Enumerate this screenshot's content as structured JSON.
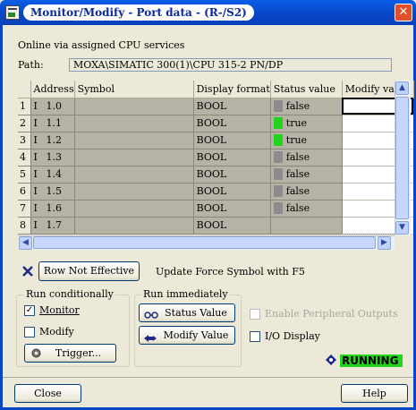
{
  "window": {
    "title": "Monitor/Modify - Port data - (R-/S2)",
    "close_symbol": "✕"
  },
  "connection_text": "Online via assigned CPU services",
  "path": {
    "label": "Path:",
    "value": "MOXA\\SIMATIC 300(1)\\CPU 315-2 PN/DP"
  },
  "table": {
    "headers": [
      "",
      "Address",
      "Symbol",
      "Display format",
      "Status value",
      "Modify value"
    ],
    "rows": [
      {
        "num": "1",
        "area": "I",
        "addr": "1.0",
        "symbol": "",
        "format": "BOOL",
        "status": "false",
        "modify": ""
      },
      {
        "num": "2",
        "area": "I",
        "addr": "1.1",
        "symbol": "",
        "format": "BOOL",
        "status": "true",
        "modify": ""
      },
      {
        "num": "3",
        "area": "I",
        "addr": "1.2",
        "symbol": "",
        "format": "BOOL",
        "status": "true",
        "modify": ""
      },
      {
        "num": "4",
        "area": "I",
        "addr": "1.3",
        "symbol": "",
        "format": "BOOL",
        "status": "false",
        "modify": ""
      },
      {
        "num": "5",
        "area": "I",
        "addr": "1.4",
        "symbol": "",
        "format": "BOOL",
        "status": "false",
        "modify": ""
      },
      {
        "num": "6",
        "area": "I",
        "addr": "1.5",
        "symbol": "",
        "format": "BOOL",
        "status": "false",
        "modify": ""
      },
      {
        "num": "7",
        "area": "I",
        "addr": "1.6",
        "symbol": "",
        "format": "BOOL",
        "status": "false",
        "modify": ""
      },
      {
        "num": "8",
        "area": "I",
        "addr": "1.7",
        "symbol": "",
        "format": "BOOL",
        "status": "",
        "modify": ""
      }
    ]
  },
  "row_not_effective_button": "Row Not Effective",
  "force_hint": "Update Force Symbol with F5",
  "run_conditionally": {
    "title": "Run conditionally",
    "monitor_label": "Monitor",
    "monitor_checked": true,
    "modify_label": "Modify",
    "modify_checked": false,
    "trigger_button": "Trigger..."
  },
  "run_immediately": {
    "title": "Run immediately",
    "status_value_button": "Status Value",
    "modify_value_button": "Modify Value"
  },
  "enable_peripheral_outputs": {
    "label": "Enable Peripheral Outputs",
    "enabled": false,
    "checked": false
  },
  "io_display": {
    "label": "I/O Display",
    "checked": false
  },
  "run_state": {
    "text": "RUNNING",
    "color": "#22d41c"
  },
  "footer": {
    "close_button": "Close",
    "help_button": "Help"
  },
  "colors": {
    "title_bar": "#0846c8",
    "status_true": "#22d41c",
    "status_false": "#8c8c8c"
  }
}
